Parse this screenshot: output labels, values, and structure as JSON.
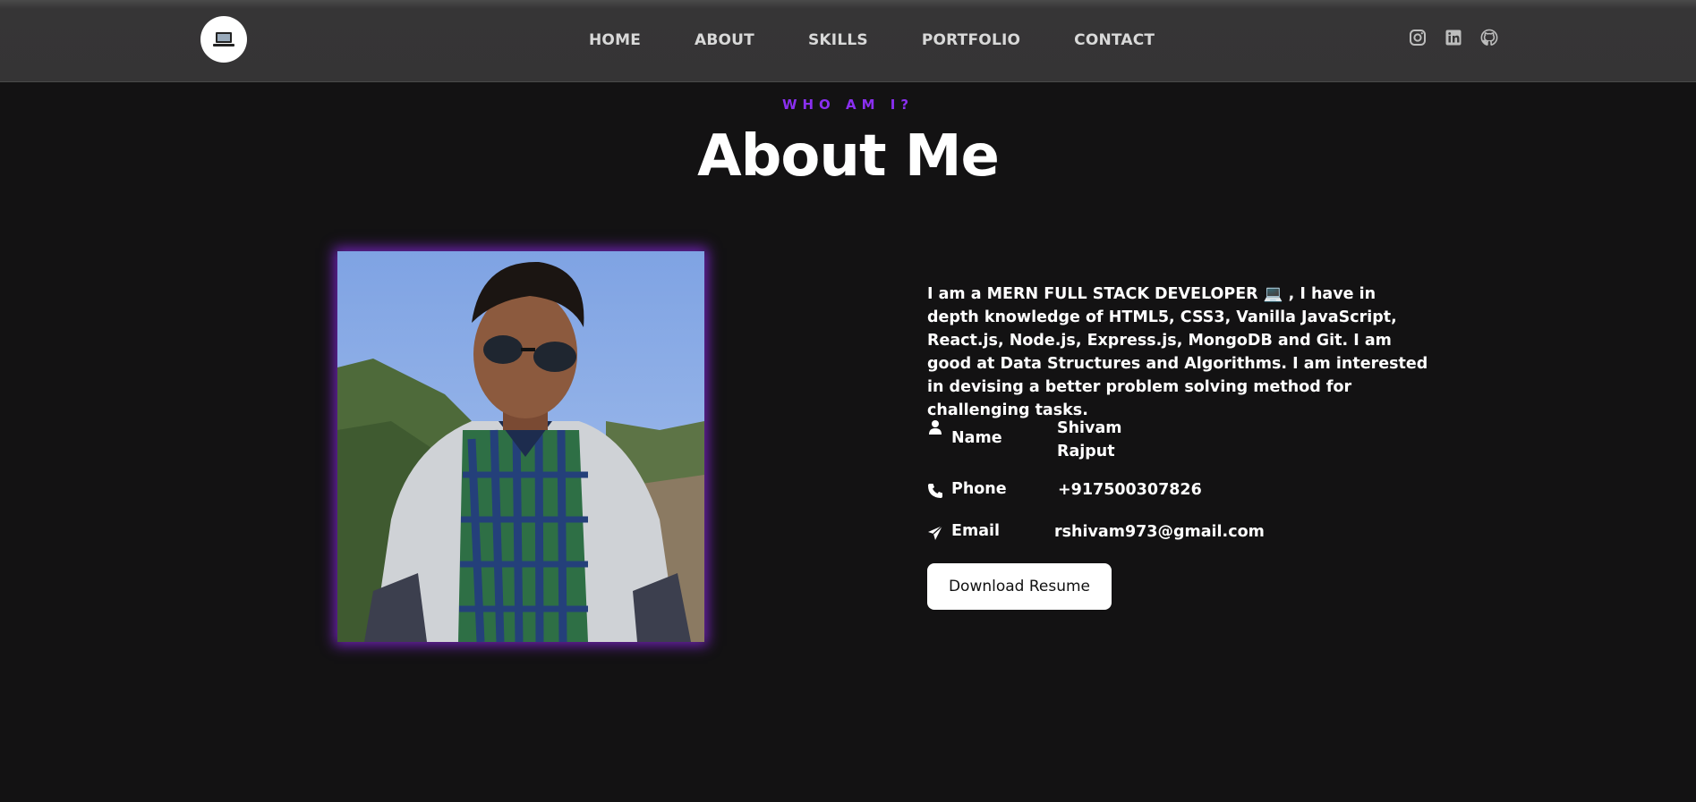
{
  "nav": {
    "logo_icon": "laptop-icon",
    "links": [
      "HOME",
      "ABOUT",
      "SKILLS",
      "PORTFOLIO",
      "CONTACT"
    ],
    "socials": [
      "instagram-icon",
      "linkedin-icon",
      "github-icon"
    ]
  },
  "section": {
    "eyebrow": "WHO AM I?",
    "title": "About Me"
  },
  "about": {
    "bio": "I am a MERN FULL STACK DEVELOPER 💻 , I have in depth knowledge of HTML5, CSS3, Vanilla JavaScript, React.js, Node.js, Express.js, MongoDB and Git. I am good at Data Structures and Algorithms. I am interested in devising a better problem solving method for challenging tasks.",
    "name_label": "Name",
    "name_value_first": "Shivam",
    "name_value_last": "Rajput",
    "phone_label": "Phone",
    "phone_value": "+917500307826",
    "email_label": "Email",
    "email_value": "rshivam973@gmail.com",
    "resume_button": "Download Resume"
  },
  "colors": {
    "background": "#131213",
    "navbar": "#353435",
    "accent": "#8a2ff0",
    "text": "#ffffff"
  }
}
